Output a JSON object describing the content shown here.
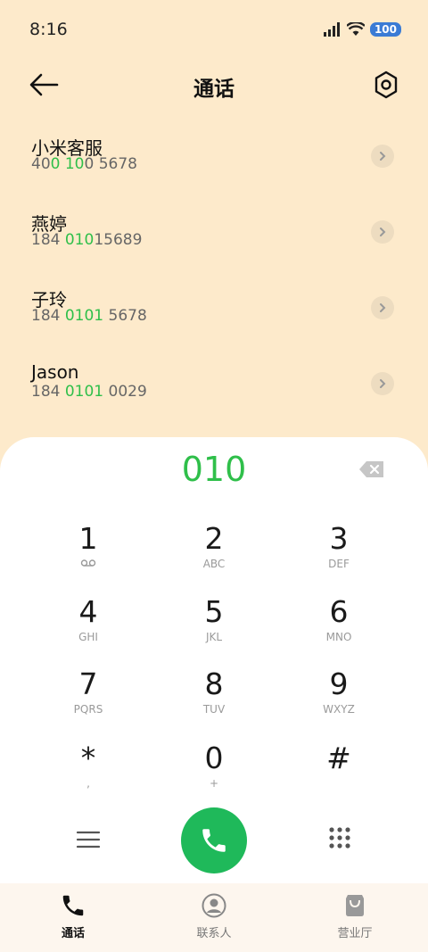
{
  "status": {
    "time": "8:16",
    "battery": "100"
  },
  "header": {
    "title": "通话"
  },
  "contacts": [
    {
      "name": "小米客服",
      "num_pre": "40",
      "num_hl": "0 10",
      "num_post": "0 5678"
    },
    {
      "name": "燕婷",
      "num_pre": "184 ",
      "num_hl": "010",
      "num_post": "15689"
    },
    {
      "name": "子玲",
      "num_pre": "184 ",
      "num_hl": "0101",
      "num_post": " 5678"
    },
    {
      "name": "Jason",
      "num_pre": "184 ",
      "num_hl": "0101",
      "num_post": " 0029"
    }
  ],
  "dialpad": {
    "display": "010",
    "keys": [
      {
        "digit": "1",
        "sub": ""
      },
      {
        "digit": "2",
        "sub": "ABC"
      },
      {
        "digit": "3",
        "sub": "DEF"
      },
      {
        "digit": "4",
        "sub": "GHI"
      },
      {
        "digit": "5",
        "sub": "JKL"
      },
      {
        "digit": "6",
        "sub": "MNO"
      },
      {
        "digit": "7",
        "sub": "PQRS"
      },
      {
        "digit": "8",
        "sub": "TUV"
      },
      {
        "digit": "9",
        "sub": "WXYZ"
      },
      {
        "digit": "*",
        "sub": ","
      },
      {
        "digit": "0",
        "sub": "+"
      },
      {
        "digit": "#",
        "sub": ""
      }
    ]
  },
  "tabs": [
    {
      "label": "通话",
      "icon": "phone-icon"
    },
    {
      "label": "联系人",
      "icon": "person-icon"
    },
    {
      "label": "营业厅",
      "icon": "bag-icon"
    }
  ],
  "colors": {
    "accent": "#2fbf4a",
    "call": "#1fb95a",
    "background": "#fdeacb"
  }
}
